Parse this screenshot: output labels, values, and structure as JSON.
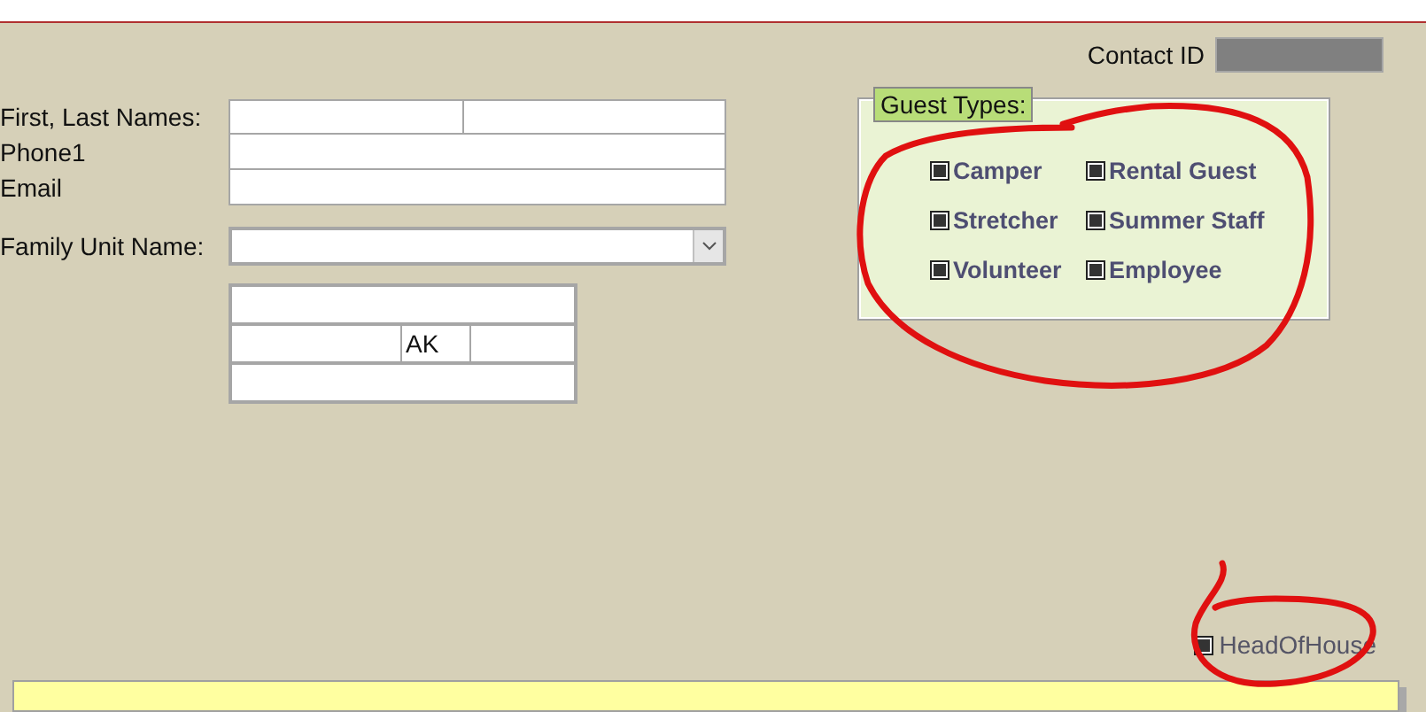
{
  "contact_id": {
    "label": "Contact ID"
  },
  "fields": [
    {
      "label": "First, Last Names:",
      "kind": "split"
    },
    {
      "label": "Phone1",
      "kind": "text"
    },
    {
      "label": "Email",
      "kind": "text"
    }
  ],
  "family_unit": {
    "label": "Family Unit Name:"
  },
  "address": {
    "state": "AK"
  },
  "guest_types": {
    "title": "Guest Types:",
    "options": [
      {
        "label": "Camper",
        "indeterminate": true
      },
      {
        "label": "Rental Guest",
        "indeterminate": true
      },
      {
        "label": "Stretcher",
        "indeterminate": true
      },
      {
        "label": "Summer Staff",
        "indeterminate": true
      },
      {
        "label": "Volunteer",
        "indeterminate": true
      },
      {
        "label": "Employee",
        "indeterminate": true
      }
    ]
  },
  "head_of_house": {
    "label": "HeadOfHouse",
    "indeterminate": true
  }
}
